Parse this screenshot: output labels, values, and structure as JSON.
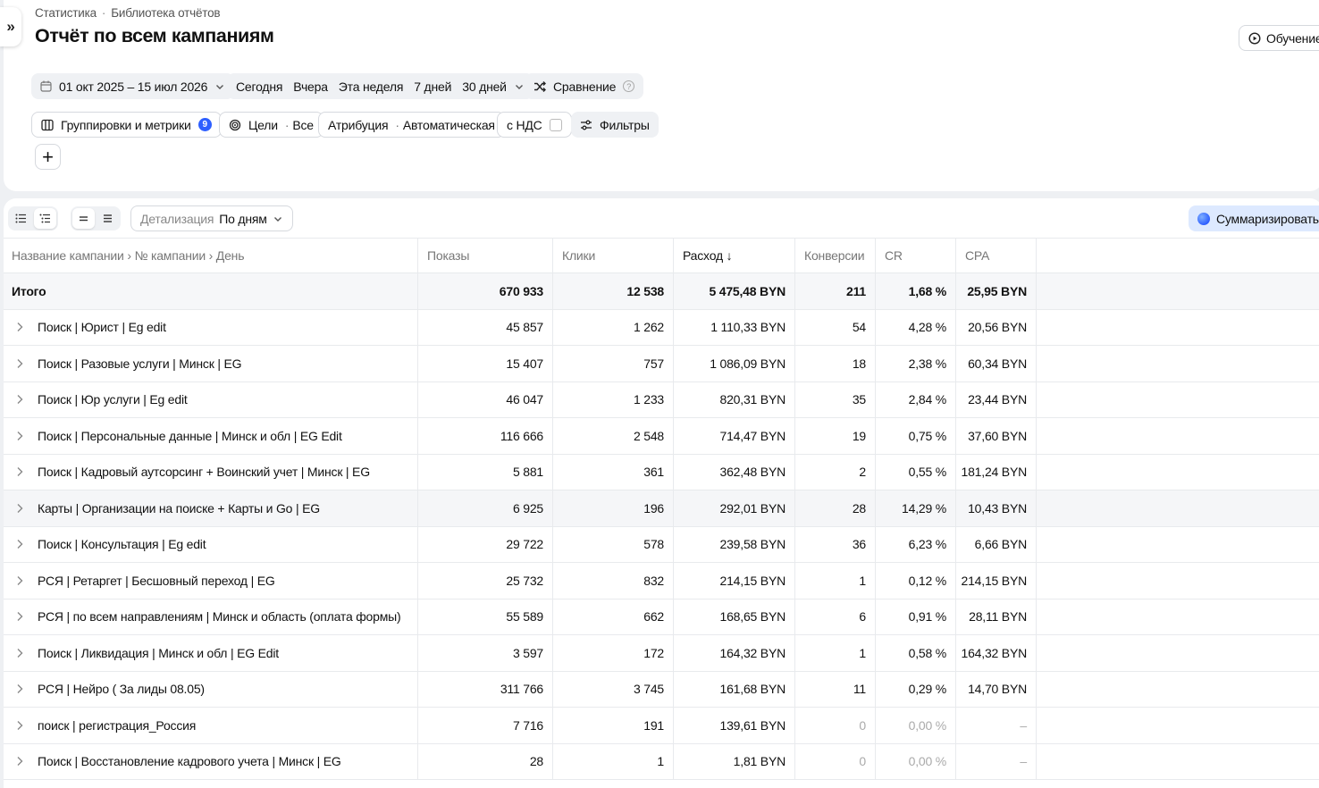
{
  "breadcrumb": [
    "Статистика",
    "Библиотека отчётов"
  ],
  "breadcrumb_sep": "·",
  "page_title": "Отчёт по всем кампаниям",
  "learn_label": "Обучение",
  "date_range": "01 окт 2025 – 15 июл 2026",
  "quick_periods": [
    "Сегодня",
    "Вчера",
    "Эта неделя",
    "7 дней",
    "30 дней"
  ],
  "comparison_label": "Сравнение",
  "groupings_label": "Группировки и метрики",
  "groupings_count": "9",
  "goals_label": "Цели",
  "goals_value": "Все",
  "attribution_label": "Атрибуция",
  "attribution_value": "Автоматическая",
  "vat_label": "с НДС",
  "filters_label": "Фильтры",
  "add_symbol": "+",
  "detail_label": "Детализация",
  "detail_value": "По дням",
  "summarize_label": "Суммаризировать",
  "table": {
    "columns": [
      "Название кампании › № кампании › День",
      "Показы",
      "Клики",
      "Расход ↓",
      "Конверсии",
      "CR",
      "CPA"
    ],
    "total": [
      "Итого",
      "670 933",
      "12 538",
      "5 475,48 BYN",
      "211",
      "1,68 %",
      "25,95 BYN"
    ],
    "rows": [
      [
        "Поиск | Юрист | Eg edit",
        "45 857",
        "1 262",
        "1 110,33 BYN",
        "54",
        "4,28 %",
        "20,56 BYN"
      ],
      [
        "Поиск | Разовые услуги | Минск | EG",
        "15 407",
        "757",
        "1 086,09 BYN",
        "18",
        "2,38 %",
        "60,34 BYN"
      ],
      [
        "Поиск | Юр услуги | Eg edit",
        "46 047",
        "1 233",
        "820,31 BYN",
        "35",
        "2,84 %",
        "23,44 BYN"
      ],
      [
        "Поиск | Персональные данные | Минск и обл | EG Edit",
        "116 666",
        "2 548",
        "714,47 BYN",
        "19",
        "0,75 %",
        "37,60 BYN"
      ],
      [
        "Поиск | Кадровый аутсорсинг + Воинский учет | Минск | EG",
        "5 881",
        "361",
        "362,48 BYN",
        "2",
        "0,55 %",
        "181,24 BYN"
      ],
      [
        "Карты | Организации на поиске + Карты и Go | EG",
        "6 925",
        "196",
        "292,01 BYN",
        "28",
        "14,29 %",
        "10,43 BYN"
      ],
      [
        "Поиск | Консультация | Eg edit",
        "29 722",
        "578",
        "239,58 BYN",
        "36",
        "6,23 %",
        "6,66 BYN"
      ],
      [
        "РСЯ | Ретаргет | Бесшовный переход | EG",
        "25 732",
        "832",
        "214,15 BYN",
        "1",
        "0,12 %",
        "214,15 BYN"
      ],
      [
        "РСЯ | по всем направлениям | Минск и область (оплата формы)",
        "55 589",
        "662",
        "168,65 BYN",
        "6",
        "0,91 %",
        "28,11 BYN"
      ],
      [
        "Поиск | Ликвидация | Минск и обл | EG Edit",
        "3 597",
        "172",
        "164,32 BYN",
        "1",
        "0,58 %",
        "164,32 BYN"
      ],
      [
        "РСЯ | Нейро ( За лиды 08.05)",
        "311 766",
        "3 745",
        "161,68 BYN",
        "11",
        "0,29 %",
        "14,70 BYN"
      ],
      [
        "поиск | регистрация_Россия",
        "7 716",
        "191",
        "139,61 BYN",
        "0",
        "0,00 %",
        "–"
      ],
      [
        "Поиск | Восстановление кадрового учета | Минск | EG",
        "28",
        "1",
        "1,81 BYN",
        "0",
        "0,00 %",
        "–"
      ]
    ]
  }
}
